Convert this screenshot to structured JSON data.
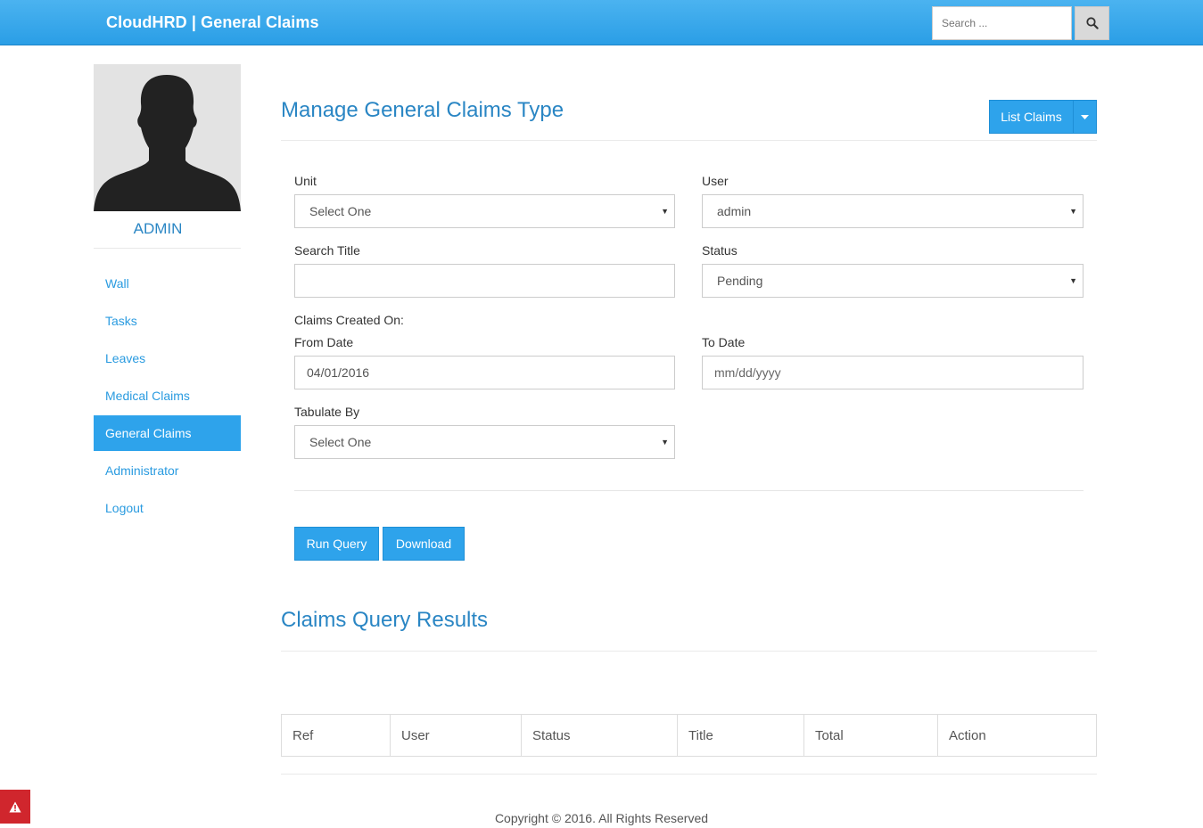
{
  "header": {
    "brand": "CloudHRD | General Claims",
    "search_placeholder": "Search ..."
  },
  "sidebar": {
    "username": "ADMIN",
    "items": [
      {
        "label": "Wall"
      },
      {
        "label": "Tasks"
      },
      {
        "label": "Leaves"
      },
      {
        "label": "Medical Claims"
      },
      {
        "label": "General Claims"
      },
      {
        "label": "Administrator"
      },
      {
        "label": "Logout"
      }
    ],
    "active_index": 4
  },
  "main": {
    "title": "Manage General Claims Type",
    "list_claims_label": "List Claims",
    "form": {
      "unit_label": "Unit",
      "unit_value": "Select One",
      "user_label": "User",
      "user_value": "admin",
      "search_title_label": "Search Title",
      "search_title_value": "",
      "status_label": "Status",
      "status_value": "Pending",
      "claims_created_label": "Claims Created On:",
      "from_date_label": "From Date",
      "from_date_value": "04/01/2016",
      "to_date_label": "To Date",
      "to_date_placeholder": "mm/dd/yyyy",
      "tabulate_label": "Tabulate By",
      "tabulate_value": "Select One"
    },
    "run_query_label": "Run Query",
    "download_label": "Download",
    "results_title": "Claims Query Results",
    "table_columns": [
      "Ref",
      "User",
      "Status",
      "Title",
      "Total",
      "Action"
    ]
  },
  "footer": {
    "copyright": "Copyright © 2016. All Rights Reserved"
  },
  "colors": {
    "accent": "#2ea3eb",
    "title": "#2a86c4",
    "alert": "#d0262d"
  }
}
